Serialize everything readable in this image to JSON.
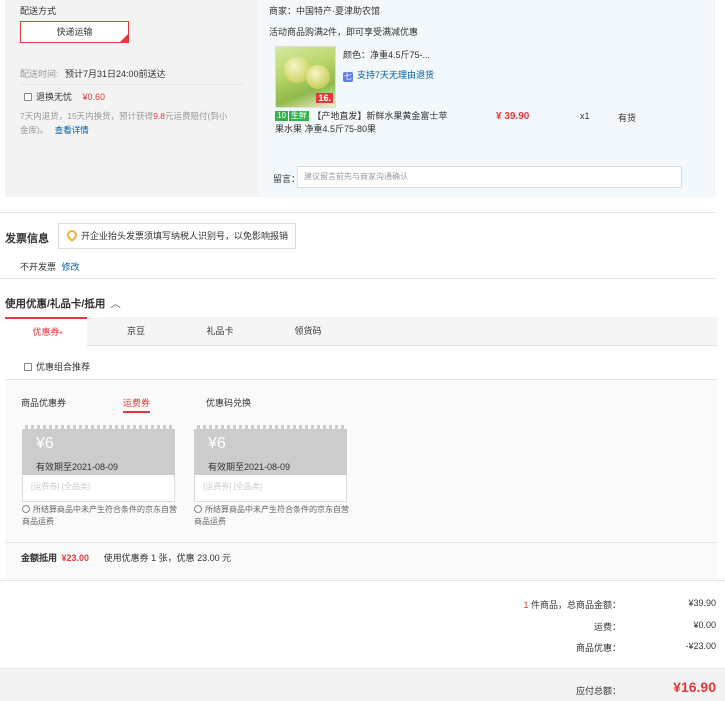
{
  "shipping": {
    "title": "配送方式",
    "method_button": "快递运输",
    "time_label": "配送时间:",
    "time_value": "预计7月31日24:00前送达",
    "insurance_label": "退换无忧",
    "insurance_price": "¥0.60",
    "insurance_desc_1": "7天内退货，15天内换货，预计获得",
    "insurance_desc_amount": "9.8",
    "insurance_desc_2": "元运费赔付(到小",
    "insurance_desc_3": "金库)。",
    "insurance_link": "查看详情"
  },
  "seller": {
    "label": "商家：",
    "name": "中国特产·夏津助农馆",
    "promo": "活动商品购满2件，即可享受满减优惠",
    "color_label": "颜色：",
    "color_value": "净重4.5斤75-...",
    "return_badge": "七",
    "return_text": "支持7天无理由退货",
    "product_badge": "生鲜",
    "product_badge_prefix": "10",
    "product_title_1": "【产地直发】新鲜水果黄金富士苹",
    "product_title_2": "果水果 净重4.5斤75-80果",
    "price": "¥ 39.90",
    "qty": "x1",
    "stock": "有货",
    "image_tag": "16.",
    "message_label": "留言：",
    "message_placeholder": "建议留言前先与商家沟通确认"
  },
  "invoice": {
    "title": "发票信息",
    "tip": "开企业抬头发票须填写纳税人识别号，以免影响报销",
    "status": "不开发票",
    "edit_link": "修改"
  },
  "discount": {
    "title": "使用优惠/礼品卡/抵用",
    "tabs": [
      {
        "label": "优惠券",
        "active": true,
        "star": "*"
      },
      {
        "label": "京豆",
        "active": false
      },
      {
        "label": "礼品卡",
        "active": false
      },
      {
        "label": "领货码",
        "active": false
      }
    ],
    "combo_label": "优惠组合推荐",
    "sub_tabs": [
      {
        "label": "商品优惠券"
      },
      {
        "label": "运费券"
      },
      {
        "label": "优惠码兑换"
      }
    ],
    "coupons": [
      {
        "amount": "¥6",
        "expiry": "有效期至2021-08-09",
        "tags": "[运费券] [全品类]",
        "note": "所结算商品中未产生符合条件的京东自营商品运费"
      },
      {
        "amount": "¥6",
        "expiry": "有效期至2021-08-09",
        "tags": "[运费券] [全品类]",
        "note": "所结算商品中未产生符合条件的京东自营商品运费"
      }
    ],
    "summary_label": "金额抵用",
    "summary_amount": "¥23.00",
    "summary_detail": "使用优惠券 1 张，优惠 23.00 元"
  },
  "totals": {
    "count": "1",
    "count_suffix": "件商品，总商品金额：",
    "goods_total": "¥39.90",
    "freight_label": "运费：",
    "freight": "¥0.00",
    "discount_label": "商品优惠：",
    "discount": "-¥23.00",
    "payable_label": "应付总额：",
    "payable": "¥16.90"
  },
  "colors": {
    "accent": "#e4393c",
    "link": "#005ea7"
  }
}
